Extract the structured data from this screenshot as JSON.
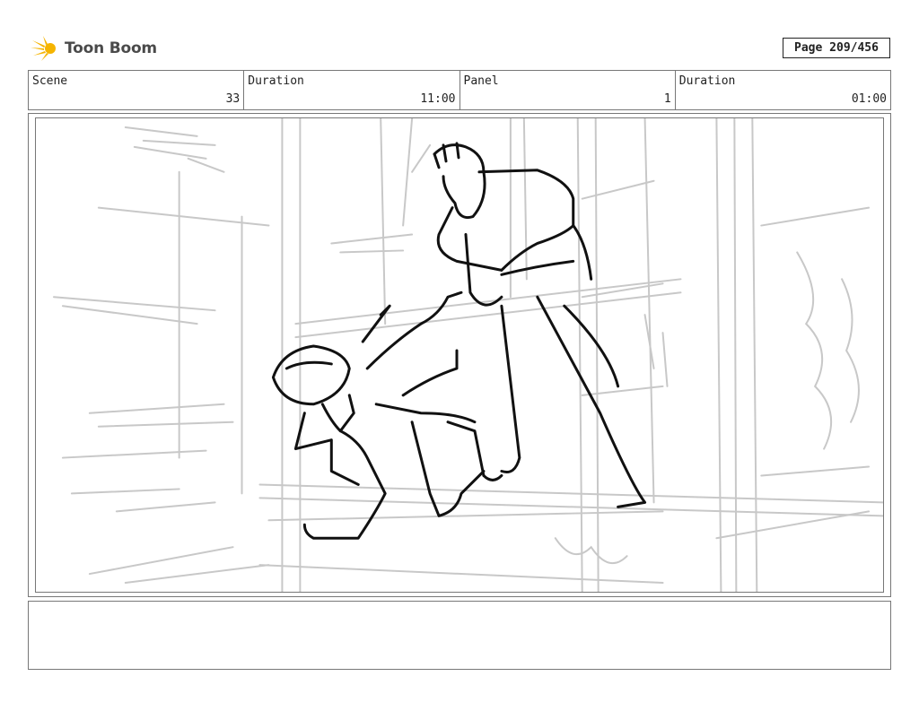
{
  "brand": {
    "name": "Toon Boom",
    "icon": "toon-boom-sun-logo",
    "accent": "#f5b400"
  },
  "page": {
    "label": "Page 209/456"
  },
  "header": [
    {
      "label": "Scene",
      "value": "33"
    },
    {
      "label": "Duration",
      "value": "11:00"
    },
    {
      "label": "Panel",
      "value": "1"
    },
    {
      "label": "Duration",
      "value": "01:00"
    }
  ],
  "panel": {
    "description_icon": "storyboard-sketch-image"
  },
  "notes": {
    "text": ""
  }
}
